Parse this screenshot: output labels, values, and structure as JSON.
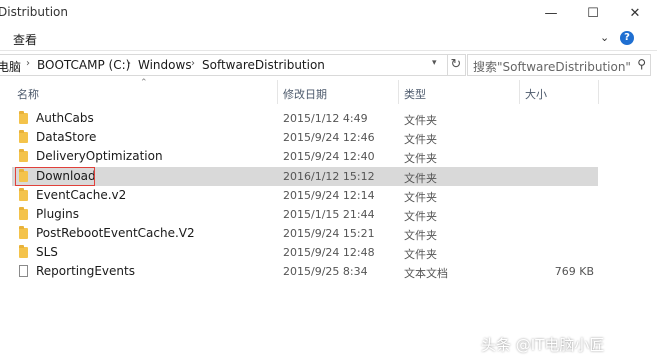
{
  "window": {
    "title": "Distribution"
  },
  "ribbon": {
    "view_tab": "查看",
    "expand_symbol": "⌄",
    "help_symbol": "?"
  },
  "address": {
    "crumbs": [
      "电脑",
      "BOOTCAMP (C:)",
      "Windows",
      "SoftwareDistribution"
    ],
    "separator": "›"
  },
  "search": {
    "placeholder": "搜索\"SoftwareDistribution\""
  },
  "columns": {
    "name": "名称",
    "date": "修改日期",
    "type": "类型",
    "size": "大小"
  },
  "files": [
    {
      "name": "AuthCabs",
      "date": "2015/1/12 4:49",
      "type": "文件夹",
      "size": "",
      "kind": "folder",
      "state": "normal"
    },
    {
      "name": "DataStore",
      "date": "2015/9/24 12:46",
      "type": "文件夹",
      "size": "",
      "kind": "folder",
      "state": "normal"
    },
    {
      "name": "DeliveryOptimization",
      "date": "2015/9/24 12:40",
      "type": "文件夹",
      "size": "",
      "kind": "folder",
      "state": "normal"
    },
    {
      "name": "Download",
      "date": "2016/1/12 15:12",
      "type": "文件夹",
      "size": "",
      "kind": "folder",
      "state": "selected"
    },
    {
      "name": "EventCache.v2",
      "date": "2015/9/24 12:14",
      "type": "文件夹",
      "size": "",
      "kind": "folder",
      "state": "normal"
    },
    {
      "name": "Plugins",
      "date": "2015/1/15 21:44",
      "type": "文件夹",
      "size": "",
      "kind": "folder",
      "state": "normal"
    },
    {
      "name": "PostRebootEventCache.V2",
      "date": "2015/9/24 15:21",
      "type": "文件夹",
      "size": "",
      "kind": "folder",
      "state": "normal"
    },
    {
      "name": "SLS",
      "date": "2015/9/24 12:48",
      "type": "文件夹",
      "size": "",
      "kind": "folder",
      "state": "normal"
    },
    {
      "name": "ReportingEvents",
      "date": "2015/9/25 8:34",
      "type": "文本文档",
      "size": "769 KB",
      "kind": "file",
      "state": "normal"
    }
  ],
  "watermark": "头条 @IT电脑小匠",
  "colors": {
    "folder": "#f4c34b",
    "selection": "#d9d9d9",
    "highlight_box": "#e0403a",
    "help": "#1f6fd1"
  }
}
